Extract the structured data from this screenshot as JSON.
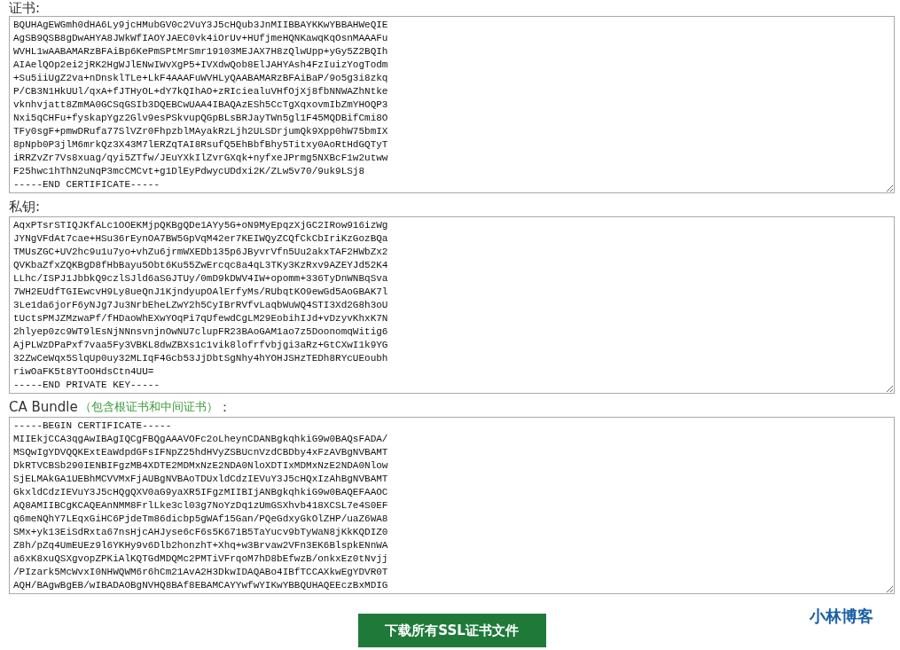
{
  "sections": [
    {
      "label": "证书:",
      "field": [
        "BQUHAgEWGmh0dHA6Ly9jcHMubGV0c2VuY3J5cHQub3JnMIIBBAYKKwYBBAHWeQIE",
        "AgSB9QSB8gDwAHYA8JWkWfIAOYJAEC0vk4iOrUv+HUfjmeHQNKawqKqOsnMAAAFu",
        "WVHL1wAABAMARzBFAiBp6KePmSPtMrSmr19103MEJAX7H8zQlwUpp+yGy5Z2BQIh",
        "AIAelQOp2ei2jRK2HgWJlENwIWvXgP5+IVXdwQob8ElJAHYAsh4FzIuizYogTodm",
        "+Su5iiUgZ2va+nDnsklTLe+LkF4AAAFuWVHLyQAABAMARzBFAiBaP/9o5g3i8zkq",
        "P/CB3N1HkUUl/qxA+fJTHyOL+dY7kQIhAO+zRIciealuVHfOjXj8fbNNWAZhNtke",
        "vknhvjatt8ZmMA0GCSqGSIb3DQEBCwUAA4IBAQAzESh5CcTgXqxovmIbZmYHOQP3",
        "Nxi5qCHFu+fyskapYgz2Glv9esPSkvupQGpBLsBRJayTWn5gl1F45MQDBifCmi8O",
        "TFy0sgF+pmwDRufa77SlVZr0FhpzblMAyakRzLjh2ULSDrjumQk9Xpp0hW75bmIX",
        "8pNpb0P3jlM6mrkQz3X43M7lERZqTAI8RsufQ5EhBbfBhy5Titxy0AoRtHdGQTyT",
        "iRRZvZr7Vs8xuag/qyi5ZTfw/JEuYXkIlZvrGXqk+nyfxeJPrmg5NXBcF1w2utww",
        "F25hwc1hThN2uNqP3mcCMCvt+g1DlEyPdwycUDdxi2K/ZLw5v70/9uk9LSj8",
        "-----END CERTIFICATE-----"
      ]
    },
    {
      "label": "私钥:",
      "field": [
        "AqxPTsrSTIQJKfALc1OOEKMjpQKBgQDe1AYy5G+oN9MyEpqzXjGC2IRow916izWg",
        "JYNgVFdAt7cae+HSu36rEynOA7BW5GpVqM42er7KEIWQyZCQfCkCbIriKzGozBQa",
        "TMUsZGC+UV2hc9u1u7yo+vhZu6jrmWXEDb135p6JByvrVfn5Uu2akxTAF2HWbZx2",
        "QVKbaZfxZQKBgD8fHbBayu5Obt6Ku55ZwErcqc8a4qL3TKy3KzRxv9AZEYJd52K4",
        "LLhc/ISPJ1JbbkQ9czlSJld6aSGJTUy/0mD9kDWV4IW+opomm+336TyDnWNBqSva",
        "7WH2EUdfTGIEwcvH9Ly8ueQnJ1KjndyupOAlErfyMs/RUbqtKO9ewGd5AoGBAK7l",
        "3Le1da6jorF6yNJg7Ju3NrbEheLZwY2h5CyIBrRVfvLaqbWuWQ4STI3Xd2G8h3oU",
        "tUctsPMJZMzwaPf/fHDaoWhEXwYOqPi7qUfewdCgLM29EobihIJd+vDzyvKhxK7N",
        "2hlyep0zc9WT9lEsNjNNnsvnjnOwNU7clupFR23BAoGAM1ao7z5DoonomqWitig6",
        "AjPLWzDPaPxf7vaa5Fy3VBKL8dwZBXs1c1vik8lofrfvbjgi3aRz+GtCXwI1k9YG",
        "32ZwCeWqx5SlqUp0uy32MLIqF4Gcb53JjDbtSgNhy4hYOHJSHzTEDh8RYcUEoubh",
        "riwOaFK5t8YToOHdsCtn4UU=",
        "-----END PRIVATE KEY-----"
      ]
    },
    {
      "label": "CA Bundle",
      "note": "（包含根证书和中间证书）",
      "suffix": "：",
      "field": [
        "-----BEGIN CERTIFICATE-----",
        "MIIEkjCCA3qgAwIBAgIQCgFBQgAAAVOFc2oLheynCDANBgkqhkiG9w0BAQsFADA/",
        "MSQwIgYDVQQKExtEaWdpdGFsIFNpZ25hdHVyZSBUcnVzdCBDby4xFzAVBgNVBAMT",
        "DkRTVCBSb290IENBIFgzMB4XDTE2MDMxNzE2NDA0NloXDTIxMDMxNzE2NDA0Nlow",
        "SjELMAkGA1UEBhMCVVMxFjAUBgNVBAoTDUxldCdzIEVuY3J5cHQxIzAhBgNVBAMT",
        "GkxldCdzIEVuY3J5cHQgQXV0aG9yaXR5IFgzMIIBIjANBgkqhkiG9w0BAQEFAAOC",
        "AQ8AMIIBCgKCAQEAnNMM8FrlLke3cl03g7NoYzDq1zUmGSXhvb418XCSL7e4S0EF",
        "q6meNQhY7LEqxGiHC6PjdeTm86dicbp5gWAf15Gan/PQeGdxyGkOlZHP/uaZ6WA8",
        "SMx+yk13EiSdRxta67nsHjcAHJyse6cF6s5K671B5TaYucv9bTyWaN8jKkKQDIZ0",
        "Z8h/pZq4UmEUEz9l6YKHy9v6Dlb2honzhT+Xhq+w3Brvaw2VFn3EK6BlspkENnWA",
        "a6xK8xuQSXgvopZPKiAlKQTGdMDQMc2PMTiVFrqoM7hD8bEfwzB/onkxEz0tNvjj",
        "/PIzark5McWvxI0NHWQWM6r6hCm21AvA2H3DkwIDAQABo4IBfTCCAXkwEgYDVR0T",
        "AQH/BAgwBgEB/wIBADAOBgNVHQ8BAf8EBAMCAYYwfwYIKwYBBQUHAQEEczBxMDIG"
      ]
    }
  ],
  "download_button": "下载所有SSL证书文件",
  "logo": "小林博客"
}
